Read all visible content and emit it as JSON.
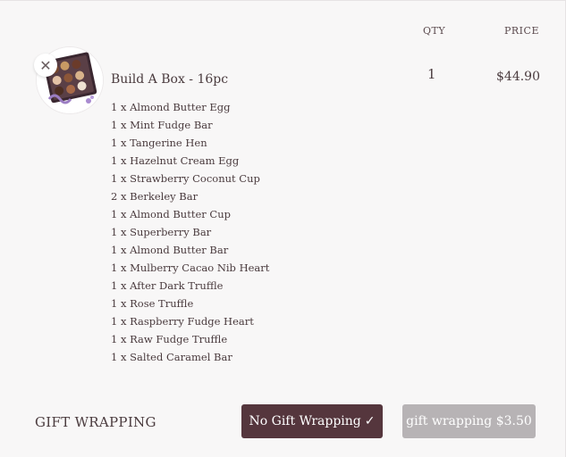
{
  "columns": {
    "qty": "QTY",
    "price": "PRICE"
  },
  "product": {
    "image_icon": "chocolate-box-image",
    "remove_icon": "close-icon",
    "remove_glyph": "✕",
    "name": "Build A Box - 16pc",
    "qty": "1",
    "price": "$44.90",
    "items": [
      "1 x Almond Butter Egg",
      "1 x Mint Fudge Bar",
      "1 x Tangerine Hen",
      "1 x Hazelnut Cream Egg",
      "1 x Strawberry Coconut Cup",
      "2 x Berkeley Bar",
      "1 x Almond Butter Cup",
      "1 x Superberry Bar",
      "1 x Almond Butter Bar",
      "1 x Mulberry Cacao Nib Heart",
      "1 x After Dark Truffle",
      "1 x Rose Truffle",
      "1 x Raspberry Fudge Heart",
      "1 x Raw Fudge Truffle",
      "1 x Salted Caramel Bar"
    ]
  },
  "gift": {
    "label": "GIFT WRAPPING",
    "no_wrap_label": "No Gift Wrapping",
    "no_wrap_check": "✓",
    "wrap_label": "gift wrapping $3.50"
  },
  "colors": {
    "background": "#f8f7f7",
    "text": "#4a3b3e",
    "selected_button": "#55363d",
    "unselected_button": "#b7b3b5"
  }
}
